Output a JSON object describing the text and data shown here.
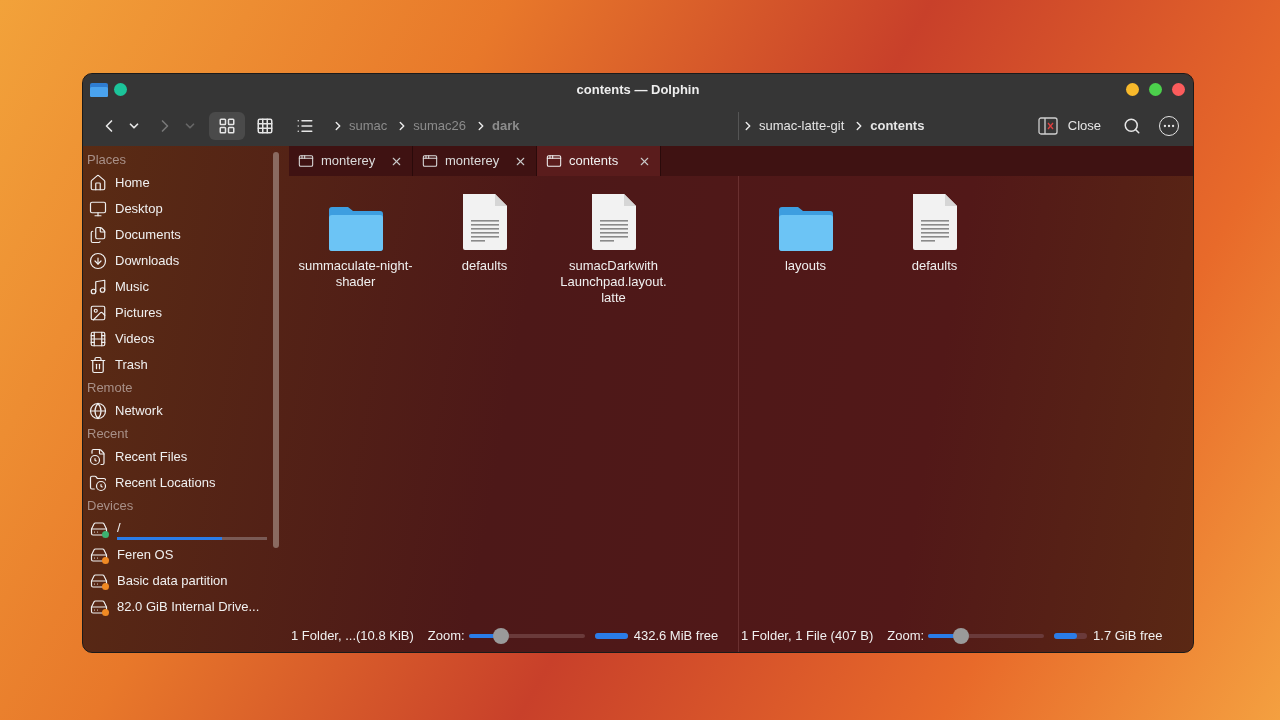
{
  "window": {
    "title": "contents — Dolphin"
  },
  "toolbar": {
    "view_modes": [
      {
        "selected": true
      },
      {
        "selected": false
      },
      {
        "selected": false
      }
    ],
    "close_label": "Close"
  },
  "tabs": [
    {
      "label": "monterey",
      "selected": false
    },
    {
      "label": "monterey",
      "selected": false
    },
    {
      "label": "contents",
      "selected": true
    }
  ],
  "sidebar": {
    "sections": [
      {
        "heading": "Places",
        "items": [
          {
            "label": "Home"
          },
          {
            "label": "Desktop"
          },
          {
            "label": "Documents"
          },
          {
            "label": "Downloads"
          },
          {
            "label": "Music"
          },
          {
            "label": "Pictures"
          },
          {
            "label": "Videos"
          },
          {
            "label": "Trash"
          }
        ]
      },
      {
        "heading": "Remote",
        "items": [
          {
            "label": "Network"
          }
        ]
      },
      {
        "heading": "Recent",
        "items": [
          {
            "label": "Recent Files"
          },
          {
            "label": "Recent Locations"
          }
        ]
      },
      {
        "heading": "Devices",
        "items": [
          {
            "label": "/",
            "color": "#3cb371",
            "level": 0.7
          },
          {
            "label": "Feren OS",
            "color": "#f08a24"
          },
          {
            "label": "Basic data partition",
            "color": "#f08a24"
          },
          {
            "label": "82.0 GiB Internal Drive...",
            "color": "#f08a24"
          }
        ]
      }
    ]
  },
  "panes": [
    {
      "active": false,
      "breadcrumb": [
        "sumac",
        "sumac26",
        "dark"
      ],
      "items": [
        {
          "name": "summaculate-night-shader",
          "kind": "folder"
        },
        {
          "name": "defaults",
          "kind": "file"
        },
        {
          "name": "sumacDarkwith Launchpad.layout. latte",
          "kind": "file"
        }
      ],
      "status": {
        "summary": "1 Folder, ...(10.8 KiB)",
        "zoom_label": "Zoom:",
        "zoom": {
          "level": 0.28
        },
        "space": {
          "level": 1.0
        },
        "free": "432.6 MiB free"
      }
    },
    {
      "active": true,
      "breadcrumb": [
        "sumac-latte-git",
        "contents"
      ],
      "items": [
        {
          "name": "layouts",
          "kind": "folder"
        },
        {
          "name": "defaults",
          "kind": "file"
        }
      ],
      "status": {
        "summary": "1 Folder, 1 File (407 B)",
        "zoom_label": "Zoom:",
        "zoom": {
          "level": 0.28
        },
        "space": {
          "level": 0.7
        },
        "free": "1.7 GiB free"
      }
    }
  ]
}
